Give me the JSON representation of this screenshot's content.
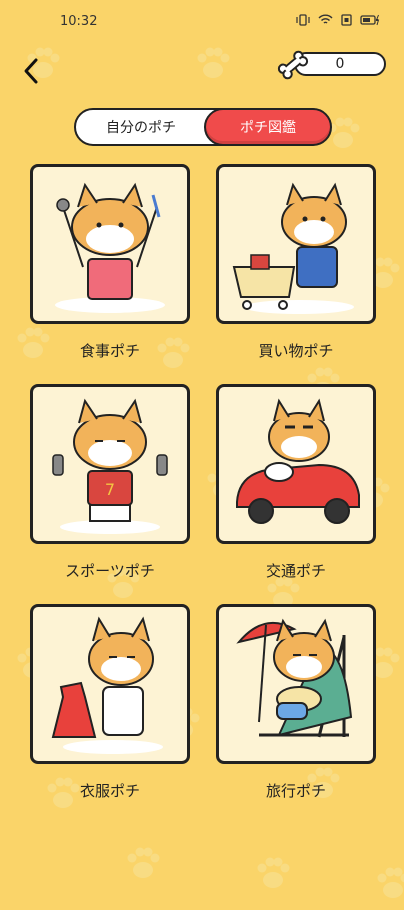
{
  "status_bar": {
    "time": "10:32"
  },
  "header": {
    "bone_count": "0"
  },
  "tabs": [
    {
      "label": "自分のポチ"
    },
    {
      "label": "ポチ図鑑"
    }
  ],
  "cards": [
    {
      "label": "食事ポチ",
      "icon": "shiba-dining"
    },
    {
      "label": "買い物ポチ",
      "icon": "shiba-shopping-cart"
    },
    {
      "label": "スポーツポチ",
      "icon": "shiba-sports-dumbbell"
    },
    {
      "label": "交通ポチ",
      "icon": "shiba-car"
    },
    {
      "label": "衣服ポチ",
      "icon": "shiba-clothes"
    },
    {
      "label": "旅行ポチ",
      "icon": "shiba-beach-chair"
    }
  ],
  "colors": {
    "background": "#FAD469",
    "accent": "#F04B4B",
    "card_bg": "#FDF3D4",
    "outline": "#222222"
  }
}
